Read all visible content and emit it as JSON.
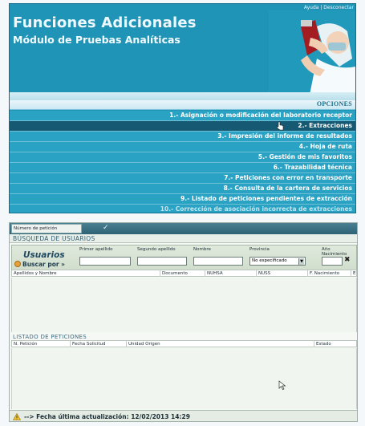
{
  "header": {
    "top_links": "Ayuda | Desconectar",
    "title": "Funciones Adicionales",
    "subtitle": "Módulo de Pruebas Analíticas",
    "accent_color": "#1f94b6"
  },
  "menu": {
    "section_title": "OPCIONES",
    "items": [
      {
        "label": "1.- Asignación o modificación del laboratorio receptor"
      },
      {
        "label": "2.- Extracciones"
      },
      {
        "label": "3.- Impresión del informe de resultados"
      },
      {
        "label": "4.- Hoja de ruta"
      },
      {
        "label": "5.- Gestión de mis favoritos"
      },
      {
        "label": "6.- Trazabilidad técnica"
      },
      {
        "label": "7.- Peticiones con error en transporte"
      },
      {
        "label": "8.- Consulta de la cartera de servicios"
      },
      {
        "label": "9.- Listado de peticiones pendientes de extracción"
      },
      {
        "label": "10.- Corrección de asociación incorrecta de extracciones"
      }
    ],
    "selected_index": 1
  },
  "search": {
    "tab_label": "Número de petición",
    "section_title": "BÚSQUEDA DE USUARIOS",
    "usuarios_label": "Usuarios",
    "buscar_label": "Buscar por",
    "fields": {
      "primer_apellido": "Primer apellido",
      "segundo_apellido": "Segundo apellido",
      "nombre": "Nombre",
      "provincia": "Provincia",
      "anio_nacimiento": "Año Nacimiento"
    },
    "provincia_value": "No especificado",
    "clear_label": "✖",
    "results_columns": [
      "Apellidos y Nombre",
      "Documento",
      "NUHSA",
      "NUSS",
      "F. Nacimiento",
      "E"
    ]
  },
  "listado": {
    "title": "LISTADO DE PETICIONES",
    "columns": [
      "N. Petición",
      "Fecha Solicitud",
      "Unidad Origen",
      "Estado"
    ]
  },
  "footer": {
    "text": "--> Fecha última actualización: 12/02/2013 14:29"
  }
}
